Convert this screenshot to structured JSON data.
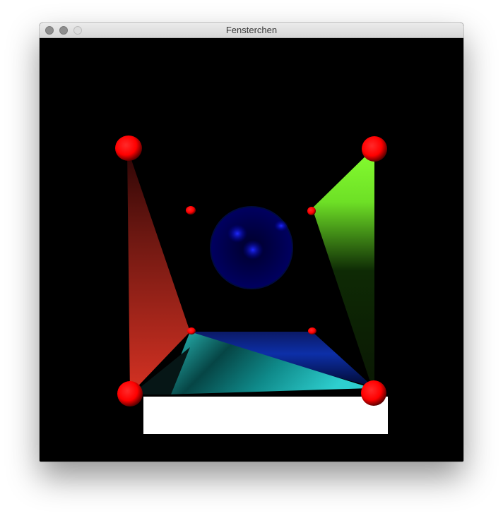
{
  "window": {
    "title": "Fensterchen",
    "controls": {
      "close": "close-icon",
      "minimize": "minimize-icon",
      "zoom": "zoom-icon"
    }
  },
  "scene": {
    "background": "#000000",
    "colors": {
      "spheres": "#ff0000",
      "center_sphere": "#0000ff",
      "left_panel": "#d42e22",
      "right_panel": "#80ff30",
      "floor_panel": "#27c4c4",
      "back_floor": "#1a3ac8",
      "floor_plane": "#ffffff"
    }
  }
}
